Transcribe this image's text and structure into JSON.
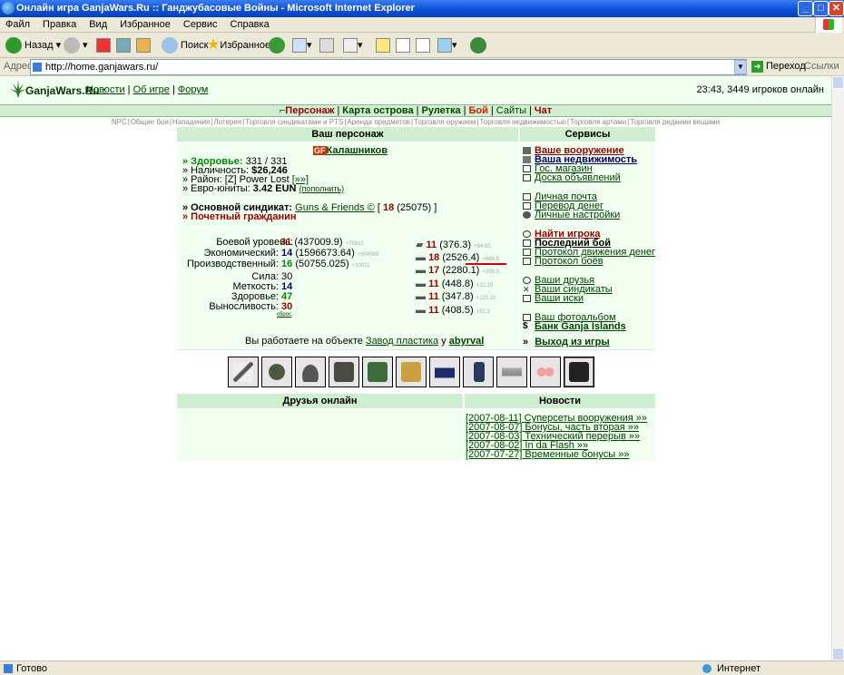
{
  "window": {
    "title": "Онлайн игра GanjaWars.Ru :: Ганджубасовые Войны - Microsoft Internet Explorer",
    "menu": [
      "Файл",
      "Правка",
      "Вид",
      "Избранное",
      "Сервис",
      "Справка"
    ],
    "toolbar": {
      "back": "Назад",
      "search": "Поиск",
      "favorites": "Избранное"
    },
    "address_label": "Адрес:",
    "address": "http://home.ganjawars.ru/",
    "go": "Переход",
    "links": "Ссылки",
    "status_left": "Готово",
    "status_right": "Интернет"
  },
  "site": {
    "title": "GanjaWars.Ru",
    "title_sep": ":",
    "top_links": [
      "Новости",
      "Об игре",
      "Форум"
    ],
    "online": "23:43, 3449 игроков онлайн",
    "nav": [
      "Персонаж",
      "Карта острова",
      "Рулетка",
      "Бой",
      "Сайты",
      "Чат"
    ],
    "subnav": [
      "NPC",
      "Общие бои",
      "Нападения",
      "Лотерея",
      "Торговля синдикатами и PTS",
      "Аренда предметов",
      "Торговля оружием",
      "Торговля недвижимостью",
      "Торговля артами",
      "Торговля редкими вещами"
    ]
  },
  "character": {
    "head": "Ваш персонаж",
    "tag": "GF",
    "name": "Калашников",
    "health_label": "» Здоровье:",
    "health": "331 / 331",
    "cash_label": "» Наличность:",
    "cash": "$26,246",
    "district_label": "» Район:",
    "district": "[Z] Power Lost",
    "district_more": "[»»]",
    "euro_label": "» Евро-юниты:",
    "euro": "3.42 EUN",
    "euro_link": "(пополнить)",
    "syndicate_label": "» Основной синдикат:",
    "syndicate": "Guns & Friends ©",
    "syndicate_bracket_open": "[",
    "syndicate_level": "18",
    "syndicate_points": "(25075)",
    "syndicate_bracket_close": "]",
    "honor": "» Почетный гражданин",
    "levels": [
      {
        "label": "Боевой уровень:",
        "value": "31",
        "exp": "(437009.9)",
        "next": "+75812"
      },
      {
        "label": "Экономический:",
        "value": "14",
        "exp": "(1596673.64)",
        "next": "+504999"
      },
      {
        "label": "Производственный:",
        "value": "16",
        "exp": "(50755.025)",
        "next": "+10011"
      }
    ],
    "stats": [
      {
        "label": "Сила:",
        "value": "30"
      },
      {
        "label": "Меткость:",
        "value": "14"
      },
      {
        "label": "Здоровье:",
        "value": "47"
      },
      {
        "label": "Выносливость:",
        "value": "30"
      }
    ],
    "reset": "сброс",
    "skills": [
      {
        "value": "11",
        "exp": "(376.3)",
        "next": "+94.65"
      },
      {
        "value": "18",
        "exp": "(2526.4)",
        "next": "+666.6"
      },
      {
        "value": "17",
        "exp": "(2280.1)",
        "next": "+208.9"
      },
      {
        "value": "11",
        "exp": "(448.8)",
        "next": "+22.15"
      },
      {
        "value": "11",
        "exp": "(347.8)",
        "next": "+123.15"
      },
      {
        "value": "11",
        "exp": "(408.5)",
        "next": "+82.5"
      }
    ],
    "work_text": "Вы работаете на объекте",
    "work_object": "Завод пластика",
    "work_at": "у",
    "work_owner": "abyrval"
  },
  "services": {
    "head": "Сервисы",
    "group1": [
      "Ваше вооружение",
      "Ваша недвижимость",
      "Гос. магазин",
      "Доска объявлений"
    ],
    "group2": [
      "Личная почта",
      "Перевод денег",
      "Личные настройки"
    ],
    "group3": [
      "Найти игрока",
      "Последний бой",
      "Протокол движения денег",
      "Протокол боёв"
    ],
    "group4": [
      "Ваши друзья",
      "Ваши синдикаты",
      "Ваши иски"
    ],
    "group5": [
      "Ваш фотоальбом",
      "Банк Ganja Islands"
    ],
    "exit_prefix": "»",
    "exit": "Выход из игры"
  },
  "equipment_icons": [
    "shotgun-icon",
    "grenade-icon",
    "helmet-icon",
    "armor-vest-icon",
    "camo-suit-icon",
    "boots-icon",
    "car-icon",
    "phone-icon",
    "gloves-icon",
    "glasses-icon",
    "laptop-icon"
  ],
  "friends": {
    "head": "Друзья онлайн"
  },
  "news": {
    "head": "Новости",
    "items": [
      "[2007-08-11] Суперсеты вооружения »»",
      "[2007-08-07] Бонусы, часть вторая »»",
      "[2007-08-03] Технический перерыв »»",
      "[2007-08-02] In da Flash »»",
      "[2007-07-27] Временные бонусы »»"
    ]
  }
}
